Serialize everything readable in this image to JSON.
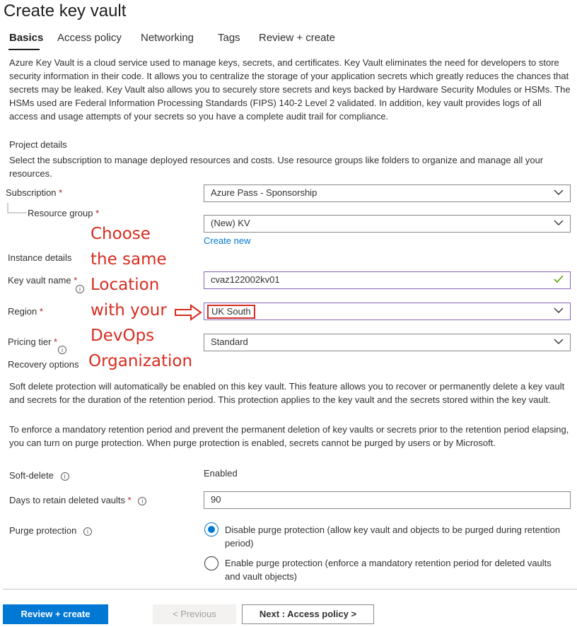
{
  "page": {
    "title": "Create key vault"
  },
  "tabs": [
    {
      "label": "Basics",
      "active": true
    },
    {
      "label": "Access policy"
    },
    {
      "label": "Networking"
    },
    {
      "label": "Tags"
    },
    {
      "label": "Review + create"
    }
  ],
  "intro": "Azure Key Vault is a cloud service used to manage keys, secrets, and certificates. Key Vault eliminates the need for developers to store security information in their code. It allows you to centralize the storage of your application secrets which greatly reduces the chances that secrets may be leaked. Key Vault also allows you to securely store secrets and keys backed by Hardware Security Modules or HSMs. The HSMs used are Federal Information Processing Standards (FIPS) 140-2 Level 2 validated. In addition, key vault provides logs of all access and usage attempts of your secrets so you have a complete audit trail for compliance.",
  "project": {
    "heading": "Project details",
    "description": "Select the subscription to manage deployed resources and costs. Use resource groups like folders to organize and manage all your resources.",
    "subscription_label": "Subscription",
    "subscription_value": "Azure Pass - Sponsorship",
    "resource_group_label": "Resource group",
    "resource_group_value": "(New) KV",
    "create_new": "Create new"
  },
  "instance": {
    "heading": "Instance details",
    "key_vault_name_label": "Key vault name",
    "key_vault_name_value": "cvaz122002kv01",
    "region_label": "Region",
    "region_value": "UK South",
    "pricing_tier_label": "Pricing tier",
    "pricing_tier_value": "Standard"
  },
  "recovery": {
    "heading": "Recovery options",
    "desc1": "Soft delete protection will automatically be enabled on this key vault. This feature allows you to recover or permanently delete a key vault and secrets for the duration of the retention period. This protection applies to the key vault and the secrets stored within the key vault.",
    "desc2": "To enforce a mandatory retention period and prevent the permanent deletion of key vaults or secrets prior to the retention period elapsing, you can turn on purge protection. When purge protection is enabled, secrets cannot be purged by users or by Microsoft.",
    "soft_delete_label": "Soft-delete",
    "soft_delete_value": "Enabled",
    "days_label": "Days to retain deleted vaults",
    "days_value": "90",
    "purge_label": "Purge protection",
    "purge_options": [
      "Disable purge protection (allow key vault and objects to be purged during retention period)",
      "Enable purge protection (enforce a mandatory retention period for deleted vaults and vault objects)"
    ],
    "purge_selected_index": 0
  },
  "annotation": {
    "lines": [
      "Choose",
      "the same",
      "Location",
      "with your",
      "DevOps",
      "Organization"
    ],
    "color": "#d62d20"
  },
  "footer": {
    "review_create": "Review + create",
    "previous": "< Previous",
    "next": "Next : Access policy >"
  },
  "colors": {
    "accent": "#0078d4",
    "active_field_border": "#8764b8",
    "valid_check": "#57a300",
    "required": "#a4262c"
  }
}
